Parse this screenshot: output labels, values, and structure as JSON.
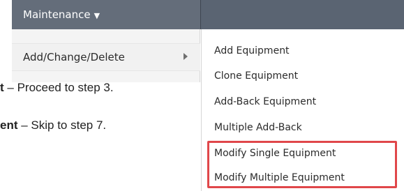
{
  "menubar": {
    "maintenance_label": "Maintenance",
    "caret_icon": "caret-down-icon"
  },
  "dropdown": {
    "add_change_delete_label": "Add/Change/Delete",
    "arrow_icon": "chevron-right-icon"
  },
  "submenu": {
    "items": [
      {
        "label": "Add Equipment"
      },
      {
        "label": "Clone Equipment"
      },
      {
        "label": "Add-Back Equipment"
      },
      {
        "label": "Multiple Add-Back"
      },
      {
        "label": "Modify Single Equipment"
      },
      {
        "label": "Modify Multiple Equipment"
      }
    ]
  },
  "document": {
    "line1_bold": "t",
    "line1_text": " – Proceed to step 3.",
    "line2_bold": "ent",
    "line2_text": " – Skip to step 7."
  },
  "colors": {
    "menubar": "#5a6472",
    "highlight": "#e0474a"
  }
}
